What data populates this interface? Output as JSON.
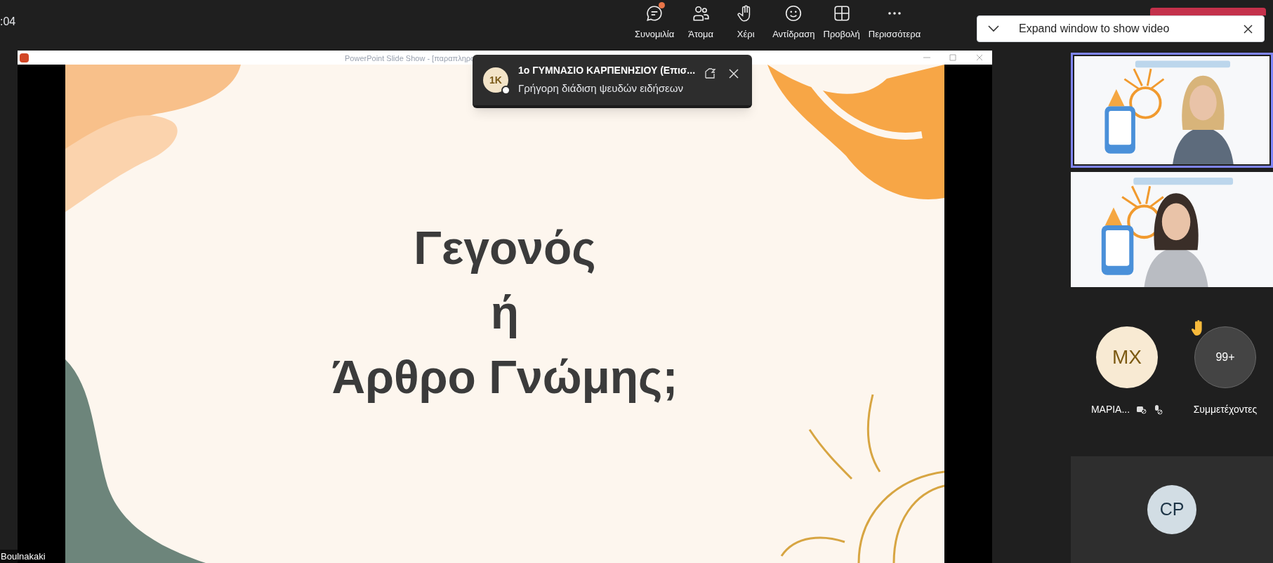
{
  "meeting_timer": ":04",
  "toolbar": [
    {
      "kind": "chat",
      "label": "Συνομιλία",
      "unread": true
    },
    {
      "kind": "people",
      "label": "Άτομα",
      "unread": false
    },
    {
      "kind": "hand",
      "label": "Χέρι",
      "unread": false
    },
    {
      "kind": "react",
      "label": "Αντίδραση",
      "unread": false
    },
    {
      "kind": "view",
      "label": "Προβολή",
      "unread": false
    },
    {
      "kind": "more",
      "label": "Περισσότερα",
      "unread": false
    }
  ],
  "expand_banner": {
    "text": "Expand window to show video"
  },
  "shared_window": {
    "title": "PowerPoint Slide Show - [παραπληρο"
  },
  "slide": {
    "lines": [
      "Γεγονός",
      "ή",
      "Άρθρο Γνώμης;"
    ]
  },
  "notification": {
    "initials": "1K",
    "name": "1ο ΓΥΜΝΑΣΙΟ ΚΑΡΠΕΝΗΣΙΟΥ (Επισ...",
    "message": "Γρήγορη διάδιση ψευδών ειδήσεων"
  },
  "presenter_label": "Boulnakaki",
  "video_tiles": [
    {
      "kind": "picture",
      "speaking": true
    },
    {
      "kind": "picture",
      "speaking": false
    }
  ],
  "participants": [
    {
      "initials": "MX",
      "name": "ΜΑΡΙΑ...",
      "camera_off": true,
      "muted": true,
      "hand_raised": false
    },
    {
      "initials": "99+",
      "name": "Συμμετέχοντες",
      "camera_off": false,
      "muted": false,
      "hand_raised": true
    }
  ],
  "bottom_tile": {
    "initials": "CP"
  }
}
